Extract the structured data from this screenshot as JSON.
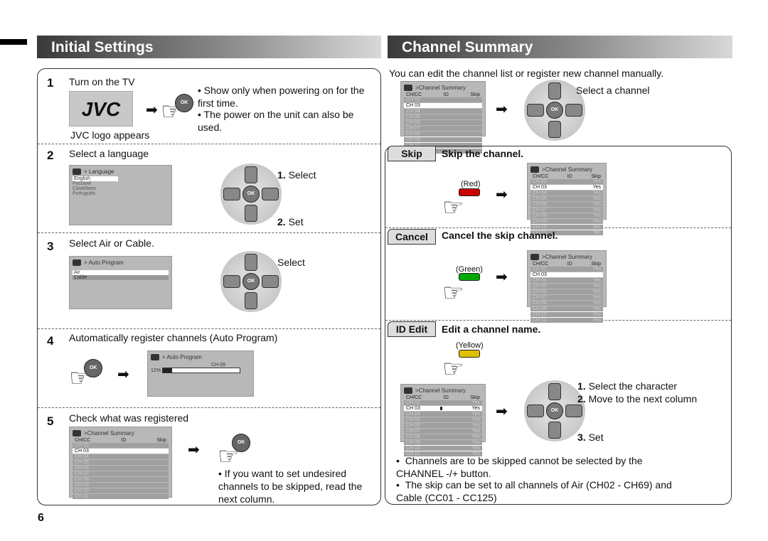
{
  "left": {
    "title": "Initial Settings",
    "s1": {
      "num": "1",
      "title": "Turn on the TV",
      "logo": "JVC",
      "logo_caption": "JVC logo appears",
      "ok": "OK",
      "bullets": [
        "Show only when powering on for the first time.",
        "The power on the unit can also be used."
      ]
    },
    "s2": {
      "num": "2",
      "title": "Select a language",
      "screen_title": "> Language",
      "options": [
        "English",
        "Русский",
        "Castellano",
        "Português"
      ],
      "select": "Select",
      "set": "Set",
      "n1": "1.",
      "n2": "2."
    },
    "s3": {
      "num": "3",
      "title": "Select Air or Cable.",
      "screen_title": "> Auto Program",
      "options": [
        "Air",
        "Cable"
      ],
      "select": "Select"
    },
    "s4": {
      "num": "4",
      "title": "Automatically register channels (Auto Program)",
      "screen_title": "> Auto Program",
      "channel": "CH 09",
      "percent": "12%",
      "progress": 12
    },
    "s5": {
      "num": "5",
      "title": "Check what was registered",
      "screen_title": ">Channel Summary",
      "note": "If you want to set undesired channels to be skipped, read the next column."
    }
  },
  "right": {
    "title": "Channel Summary",
    "intro": "You can edit the channel list or register new channel manually.",
    "select_channel": "Select a channel",
    "summary": {
      "title": ">Channel Summary",
      "cols": [
        "CH/CC",
        "ID",
        "Skip"
      ],
      "channels": [
        "CH 02",
        "CH 03",
        "CH 04",
        "CH 05",
        "CH 06",
        "CH 07",
        "CH 08",
        "CH 09",
        "CH 10",
        "CH 11"
      ],
      "yes": "Yes"
    },
    "skip": {
      "tag": "Skip",
      "title": "Skip the channel.",
      "button": "(Red)",
      "color": "#cc0000"
    },
    "cancel": {
      "tag": "Cancel",
      "title": "Cancel the skip channel.",
      "button": "(Green)",
      "color": "#00aa00"
    },
    "idedit": {
      "tag": "ID Edit",
      "title": "Edit a channel name.",
      "button": "(Yellow)",
      "color": "#e0c000",
      "n1": "1.",
      "t1": "Select the character",
      "n2": "2.",
      "t2": "Move to the next column",
      "n3": "3.",
      "t3": "Set"
    },
    "notes": [
      "Channels are to be skipped cannot be selected by the CHANNEL -/+ button.",
      "The skip can be set to all channels of Air (CH02 - CH69) and Cable (CC01 - CC125)"
    ]
  },
  "page_number": "6",
  "icons": {
    "hand": "hand-pointer-icon",
    "arrow": "right-arrow-icon",
    "pad": "remote-dpad-icon"
  }
}
